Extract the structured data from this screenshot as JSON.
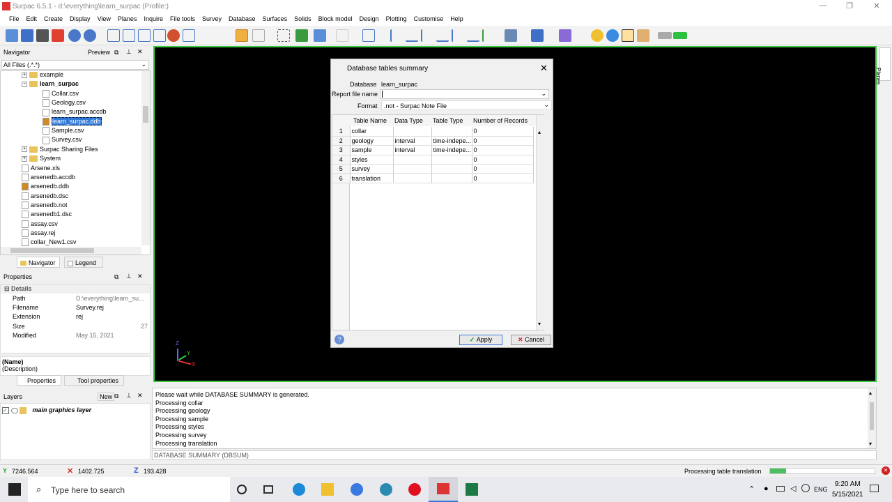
{
  "window": {
    "title": "Surpac 6.5.1 - d:\\everything\\learn_surpac (Profile:)",
    "minimize": "—",
    "maximize": "❐",
    "close": "✕"
  },
  "menu": [
    "File",
    "Edit",
    "Create",
    "Display",
    "View",
    "Planes",
    "Inquire",
    "File tools",
    "Survey",
    "Database",
    "Surfaces",
    "Solids",
    "Block model",
    "Design",
    "Plotting",
    "Customise",
    "Help"
  ],
  "navigator": {
    "title": "Navigator",
    "preview": "Preview",
    "filter": "All Files (.*.*)",
    "items": [
      {
        "label": "example",
        "type": "folder",
        "level": 1,
        "expand": "+"
      },
      {
        "label": "learn_surpac",
        "type": "folder",
        "level": 1,
        "expand": "−",
        "bold": true
      },
      {
        "label": "Collar.csv",
        "type": "file",
        "level": 2
      },
      {
        "label": "Geology.csv",
        "type": "file",
        "level": 2
      },
      {
        "label": "learn_surpac.accdb",
        "type": "file",
        "level": 2
      },
      {
        "label": "learn_surpac.ddb",
        "type": "db",
        "level": 2,
        "selected": true
      },
      {
        "label": "Sample.csv",
        "type": "file",
        "level": 2
      },
      {
        "label": "Survey.csv",
        "type": "file",
        "level": 2
      },
      {
        "label": "Surpac Sharing Files",
        "type": "folder",
        "level": 1,
        "expand": "+"
      },
      {
        "label": "System",
        "type": "folder",
        "level": 1,
        "expand": "+"
      },
      {
        "label": "Arsene.xls",
        "type": "file",
        "level": 1
      },
      {
        "label": "arsenedb.accdb",
        "type": "file",
        "level": 1
      },
      {
        "label": "arsenedb.ddb",
        "type": "db",
        "level": 1
      },
      {
        "label": "arsenedb.dsc",
        "type": "file",
        "level": 1
      },
      {
        "label": "arsenedb.not",
        "type": "file",
        "level": 1
      },
      {
        "label": "arsenedb1.dsc",
        "type": "file",
        "level": 1
      },
      {
        "label": "assay.csv",
        "type": "file",
        "level": 1
      },
      {
        "label": "assay.rej",
        "type": "file",
        "level": 1
      },
      {
        "label": "collar_New1.csv",
        "type": "file",
        "level": 1
      }
    ],
    "tabs": [
      "Navigator",
      "Legend"
    ]
  },
  "properties": {
    "title": "Properties",
    "section": "Details",
    "rows": [
      {
        "k": "Path",
        "v": "D:\\everything\\learn_su..."
      },
      {
        "k": "Filename",
        "v": "Survey.rej"
      },
      {
        "k": "Extension",
        "v": "rej"
      },
      {
        "k": "Size",
        "v": "27"
      },
      {
        "k": "Modified",
        "v": "May 15, 2021"
      }
    ],
    "name": "(Name)",
    "description": "(Description)",
    "tabs": [
      "Properties",
      "Tool properties"
    ]
  },
  "layers": {
    "title": "Layers",
    "new": "New",
    "item": "main graphics layer"
  },
  "dialog": {
    "title": "Database tables summary",
    "database_label": "Database",
    "database_value": "learn_surpac",
    "report_label": "Report file name",
    "report_value": "",
    "format_label": "Format",
    "format_value": ".not - Surpac Note File",
    "columns": [
      "Table Name",
      "Data Type",
      "Table Type",
      "Number of Records"
    ],
    "rows": [
      [
        "1",
        "collar",
        "",
        "",
        "0"
      ],
      [
        "2",
        "geology",
        "interval",
        "time-indepe...",
        "0"
      ],
      [
        "3",
        "sample",
        "interval",
        "time-indepe...",
        "0"
      ],
      [
        "4",
        "styles",
        "",
        "",
        "0"
      ],
      [
        "5",
        "survey",
        "",
        "",
        "0"
      ],
      [
        "6",
        "translation",
        "",
        "",
        "0"
      ]
    ],
    "apply": "Apply",
    "cancel": "Cancel"
  },
  "planes_tab": "Planes",
  "axes": {
    "z": "Z",
    "y": "Y",
    "x": "X"
  },
  "console": {
    "lines": [
      "Please wait while DATABASE SUMMARY is generated.",
      "Processing collar",
      "Processing geology",
      "Processing sample",
      "Processing styles",
      "Processing survey",
      "Processing translation"
    ],
    "command": "DATABASE SUMMARY (DBSUM)"
  },
  "status": {
    "y": "7246.564",
    "x": "1402.725",
    "z": "193.428",
    "message": "Processing table translation",
    "progress": 0.15
  },
  "taskbar": {
    "search": "Type here to search",
    "time": "9:20 AM",
    "date": "5/15/2021",
    "lang": "ENG"
  }
}
